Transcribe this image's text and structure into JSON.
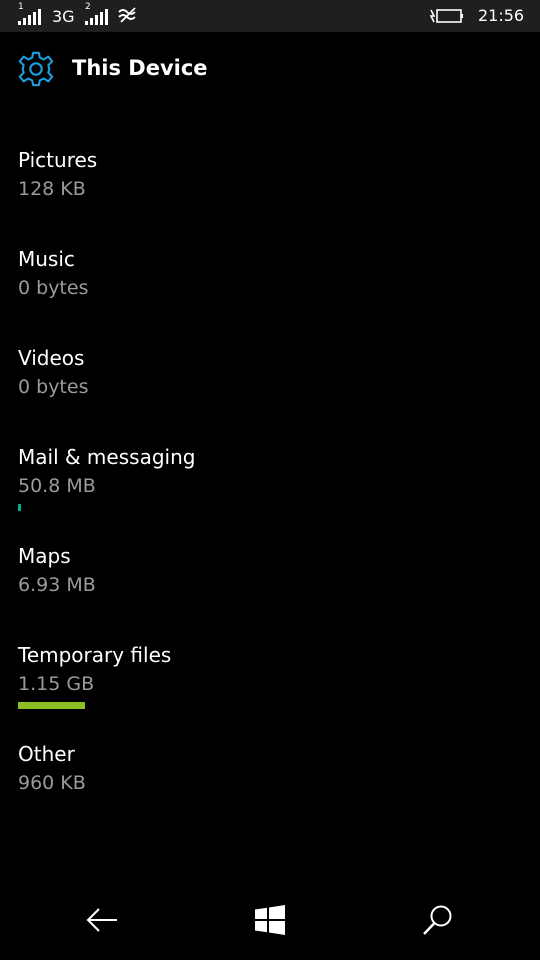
{
  "status_bar": {
    "sim1": "1",
    "sim2": "2",
    "network_type": "3G",
    "time": "21:56",
    "icons": [
      "signal-strength-icon",
      "signal-strength-icon",
      "wifi-icon",
      "battery-charging-icon"
    ]
  },
  "header": {
    "icon": "gear-icon",
    "title": "This Device"
  },
  "colors": {
    "accent": "#1ba1e2",
    "mail_bar": "#00b294",
    "temp_bar": "#8cbf26",
    "secondary_text": "#9a9a9a"
  },
  "storage_items": [
    {
      "label": "Pictures",
      "size": "128 KB"
    },
    {
      "label": "Music",
      "size": "0 bytes"
    },
    {
      "label": "Videos",
      "size": "0 bytes"
    },
    {
      "label": "Mail & messaging",
      "size": "50.8 MB",
      "usage_fraction": 0.006
    },
    {
      "label": "Maps",
      "size": "6.93 MB"
    },
    {
      "label": "Temporary files",
      "size": "1.15 GB",
      "usage_fraction": 0.134
    },
    {
      "label": "Other",
      "size": "960 KB"
    }
  ],
  "nav_bar": {
    "buttons": [
      "back-arrow-icon",
      "windows-logo-icon",
      "search-icon"
    ]
  }
}
